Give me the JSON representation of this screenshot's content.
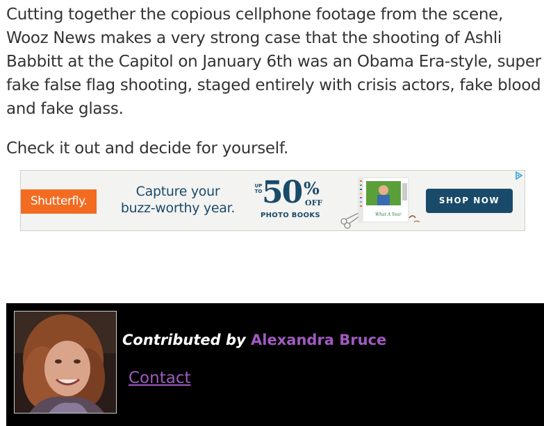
{
  "article": {
    "paragraph1": "Cutting together the copious cellphone footage from the scene, Wooz News makes a very strong case that the shooting of Ashli Babbitt at the Capitol on January 6th was an Obama Era-style, super fake false flag shooting, staged entirely with crisis actors, fake blood and fake glass.",
    "paragraph2": "Check it out and decide for yourself."
  },
  "ad": {
    "brand": "Shutterfly.",
    "headline_line1": "Capture your",
    "headline_line2": "buzz-worthy year.",
    "upto_line1": "UP",
    "upto_line2": "TO",
    "discount_number": "50",
    "discount_percent": "%",
    "discount_off": "OFF",
    "product_label": "PHOTO BOOKS",
    "book_caption": "What A Year",
    "cta_label": "SHOP NOW",
    "colors": {
      "brand_orange": "#f26b21",
      "navy": "#1a4a6a",
      "background": "#f3f3f1"
    }
  },
  "author": {
    "prefix": "Contributed by ",
    "name": "Alexandra Bruce",
    "contact_label": "Contact",
    "colors": {
      "box_background": "#000000",
      "accent": "#a05ac0"
    }
  }
}
